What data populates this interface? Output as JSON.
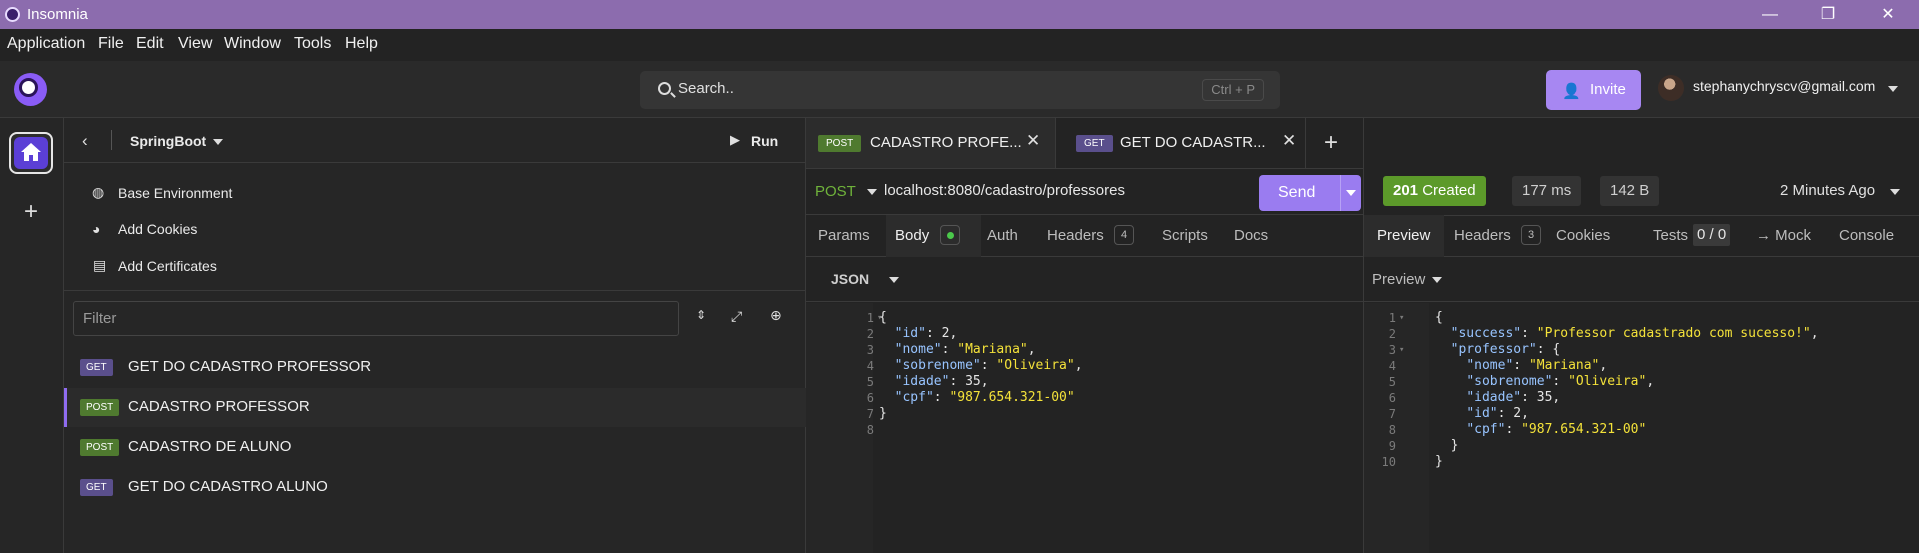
{
  "window": {
    "title": "Insomnia",
    "controls": [
      "—",
      "❐",
      "✕"
    ]
  },
  "menu": [
    "Application",
    "File",
    "Edit",
    "View",
    "Window",
    "Tools",
    "Help"
  ],
  "header": {
    "search_placeholder": "Search..",
    "search_shortcut": "Ctrl + P",
    "invite_label": "Invite",
    "user_email": "stephanychryscv@gmail.com"
  },
  "sidebar": {
    "project": "SpringBoot",
    "run_label": "Run",
    "env_items": [
      "Base Environment",
      "Add Cookies",
      "Add Certificates"
    ],
    "filter_placeholder": "Filter",
    "requests": [
      {
        "method": "GET",
        "name": "GET DO CADASTRO PROFESSOR",
        "active": false
      },
      {
        "method": "POST",
        "name": "CADASTRO PROFESSOR",
        "active": true
      },
      {
        "method": "POST",
        "name": "CADASTRO DE ALUNO",
        "active": false
      },
      {
        "method": "GET",
        "name": "GET DO CADASTRO ALUNO",
        "active": false
      }
    ]
  },
  "tabs": [
    {
      "method": "POST",
      "name": "CADASTRO PROFE...",
      "active": true
    },
    {
      "method": "GET",
      "name": "GET DO CADASTR...",
      "active": false
    }
  ],
  "request": {
    "method": "POST",
    "url": "localhost:8080/cadastro/professores",
    "send_label": "Send",
    "subtabs": [
      "Params",
      "Body",
      "Auth",
      "Headers",
      "Scripts",
      "Docs"
    ],
    "headers_count": "4",
    "body_format": "JSON",
    "body_lines": [
      "{",
      "  \"id\": 2,",
      "  \"nome\": \"Mariana\",",
      "  \"sobrenome\": \"Oliveira\",",
      "  \"idade\": 35,",
      "  \"cpf\": \"987.654.321-00\"",
      "}",
      ""
    ]
  },
  "response": {
    "status_code": "201",
    "status_text": "Created",
    "time": "177 ms",
    "size": "142 B",
    "age": "2 Minutes Ago",
    "subtabs": [
      "Preview",
      "Headers",
      "Cookies",
      "Tests",
      "→ Mock",
      "Console"
    ],
    "headers_count": "3",
    "tests_count": "0 / 0",
    "preview_label": "Preview",
    "body_lines": [
      "{",
      "  \"success\": \"Professor cadastrado com sucesso!\",",
      "  \"professor\": {",
      "    \"nome\": \"Mariana\",",
      "    \"sobrenome\": \"Oliveira\",",
      "    \"idade\": 35,",
      "    \"id\": 2,",
      "    \"cpf\": \"987.654.321-00\"",
      "  }",
      "}"
    ]
  },
  "colors": {
    "accent": "#9a7cf0",
    "titlebar": "#8c6cae",
    "post": "#4f7a2f",
    "get": "#5a4f8c",
    "status_ok": "#5c9a2a",
    "json_string": "#f4e23a",
    "json_key": "#98c4ff"
  }
}
